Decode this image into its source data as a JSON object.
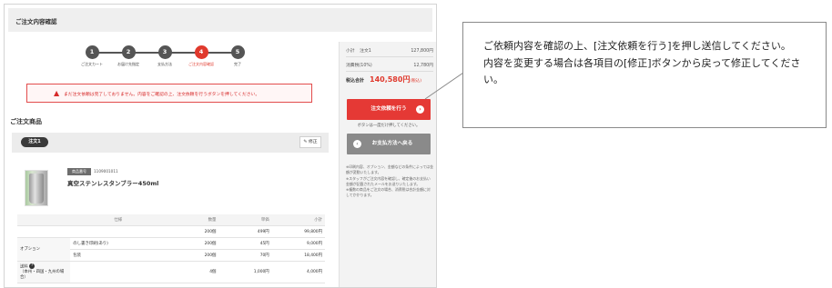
{
  "header": {
    "title": "ご注文内容確認"
  },
  "stepper": {
    "steps": [
      {
        "num": "1",
        "label": "ご注文カート"
      },
      {
        "num": "2",
        "label": "お届け先指定"
      },
      {
        "num": "3",
        "label": "支払方法"
      },
      {
        "num": "4",
        "label": "ご注文内容確認"
      },
      {
        "num": "5",
        "label": "完了"
      }
    ],
    "active_step": 4
  },
  "alert": {
    "text": "まだ注文依頼は完了しておりません。内容をご確認の上、注文依頼を行うボタンを押してください。"
  },
  "section": {
    "title": "ご注文商品"
  },
  "order": {
    "badge": "注文1",
    "edit_label": "修正"
  },
  "product": {
    "tag": "商品番号",
    "code": "1109001011",
    "name": "真空ステンレスタンブラー450ml"
  },
  "table": {
    "headers": {
      "spec": "仕様",
      "qty": "数量",
      "unit": "単価",
      "subtotal": "小計"
    },
    "base_row": {
      "qty": "200個",
      "unit": "499円",
      "subtotal": "99,800円"
    },
    "option_label": "オプション",
    "option_rows": [
      {
        "name": "のし書き印刷(あり)",
        "qty": "200個",
        "unit": "45円",
        "subtotal": "9,000円"
      },
      {
        "name": "包装",
        "qty": "200個",
        "unit": "70円",
        "subtotal": "18,400円"
      }
    ],
    "shipping": {
      "label": "送料",
      "note": "（本州・四国・九州の場合）",
      "qty": "4個",
      "unit": "1,000円",
      "subtotal": "4,000円"
    }
  },
  "summary": {
    "subtotal_label": "小計",
    "subtotal_order": "注文1",
    "subtotal_value": "127,800円",
    "tax_label": "消費税(10%)",
    "tax_value": "12,780円",
    "total_label": "税込合計",
    "total_value": "140,580円",
    "total_note": "(税込)",
    "submit_label": "注文依頼を行う",
    "once_note": "ボタンは一度だけ押してください。",
    "back_label": "お支払方法へ戻る",
    "notes": "※印刷内容、オプション、金額などの条件によっては金額が変動いたします。\n※スタッフがご注文内容を確認し、確定後のお支払い金額が記載されたメールをお送りいたします。\n※複数の商品をご注文の場合、消費税は合計金額に対してかかります。"
  },
  "callout": {
    "text": "ご依頼内容を確認の上、[注文依頼を行う]を押し送信してください。\n内容を変更する場合は各項目の[修正]ボタンから戻って修正してください。"
  },
  "colors": {
    "accent": "#e53935",
    "step_dark": "#555555",
    "back_button": "#8a8a8a"
  }
}
